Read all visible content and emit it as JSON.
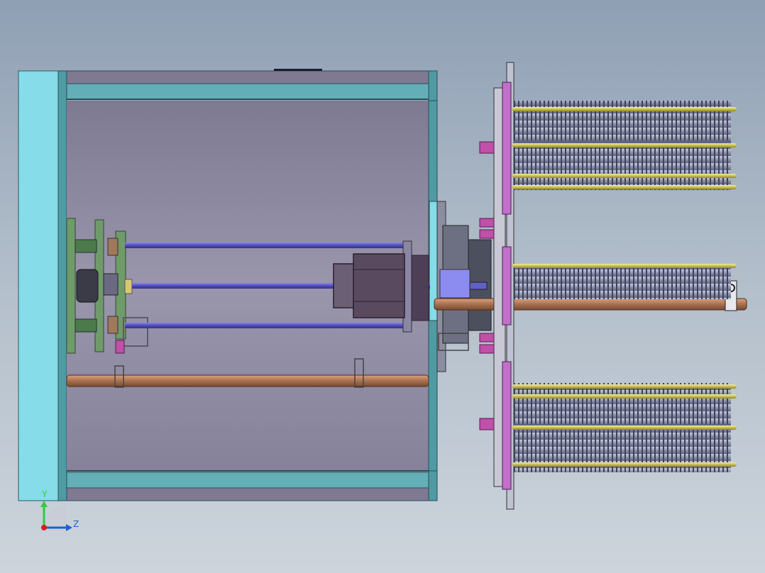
{
  "viewport": {
    "background_top": "#8fa0b4",
    "background_bottom": "#cdd4dc"
  },
  "triad": {
    "y_label": "Y",
    "z_label": "Z",
    "y_color": "#2ecc40",
    "z_color": "#1f5fd6",
    "x_color": "#d62020"
  },
  "colors": {
    "frame_cyan": "#86dce8",
    "frame_teal": "#4f9aa3",
    "cabinet_interior": "#8a86a0",
    "rod_blue": "#5b58c8",
    "rod_copper": "#b07a5a",
    "plate_green": "#6f9a6a",
    "gold_rod": "#d8d060",
    "fin_grey": "#9aa0b8",
    "flange_magenta": "#c070c8",
    "motor_dark": "#5a4a60"
  }
}
